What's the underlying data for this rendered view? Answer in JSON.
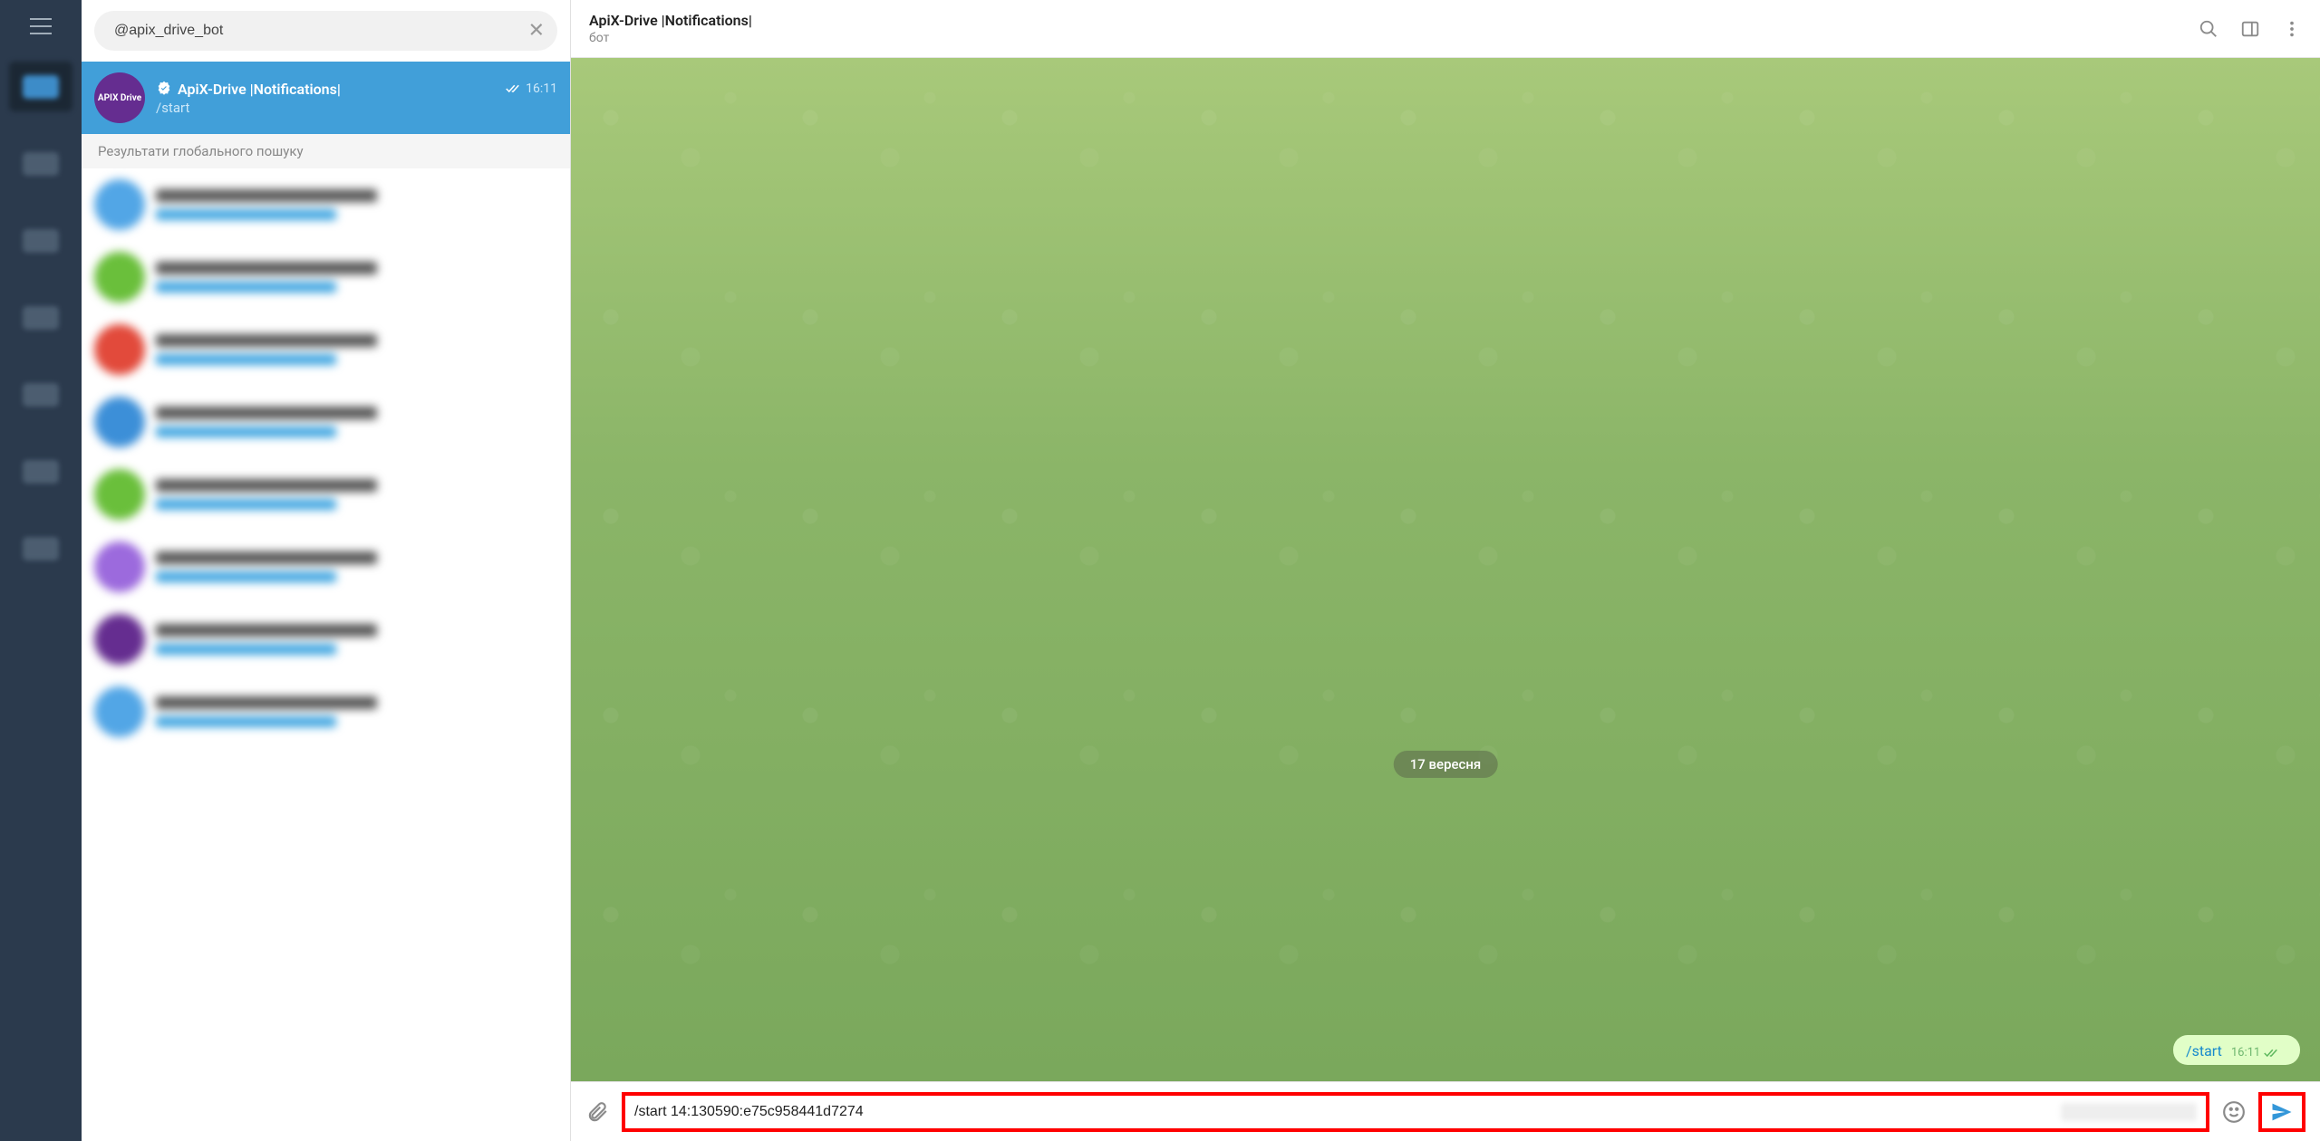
{
  "search": {
    "value": "@apix_drive_bot"
  },
  "active_chat": {
    "avatar_label": "APIX Drive",
    "title": "ApiX-Drive |Notifications|",
    "preview": "/start",
    "time": "16:11"
  },
  "global_results_header": "Результати глобального пошуку",
  "blur_items": [
    {
      "color": "#52a6e6"
    },
    {
      "color": "#6abf3b"
    },
    {
      "color": "#e24a3b"
    },
    {
      "color": "#3c8fd8"
    },
    {
      "color": "#6abf3b"
    },
    {
      "color": "#9c6add"
    },
    {
      "color": "#652d90"
    },
    {
      "color": "#52a6e6"
    }
  ],
  "conversation": {
    "title": "ApiX-Drive |Notifications|",
    "subtitle": "бот",
    "date_pill": "17 вересня",
    "sent_message": {
      "text": "/start",
      "time": "16:11"
    },
    "input_value": "/start 14:130590:e75c958441d7274"
  }
}
